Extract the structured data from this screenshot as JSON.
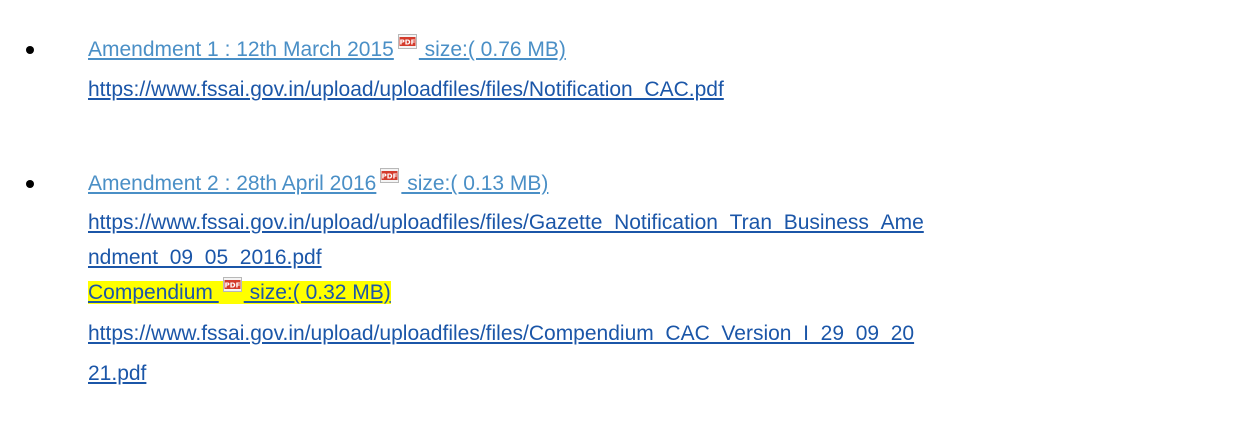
{
  "amendments": [
    {
      "title": "Amendment 1 : 12th March 2015",
      "size": " size:( 0.76 MB)",
      "url": "https://www.fssai.gov.in/upload/uploadfiles/files/Notification_CAC.pdf"
    },
    {
      "title": "Amendment 2 : 28th April 2016",
      "size": " size:( 0.13 MB)",
      "url_line1": "https://www.fssai.gov.in/upload/uploadfiles/files/Gazette_Notification_Tran_Business_Ame",
      "url_line2": "ndment_09_05_2016.pdf"
    }
  ],
  "compendium": {
    "title": "Compendium ",
    "size": " size:( 0.32 MB)",
    "url_line1": "https://www.fssai.gov.in/upload/uploadfiles/files/Compendium_CAC_Version_I_29_09_20",
    "url_line2": "21.pdf",
    "highlight_color": "#ffff00"
  },
  "icons": {
    "pdf": "pdf-file-icon",
    "bullet": "bullet-dot"
  },
  "colors": {
    "title_link": "#4a8fc6",
    "url_link": "#1b56a8",
    "text": "#000000"
  }
}
